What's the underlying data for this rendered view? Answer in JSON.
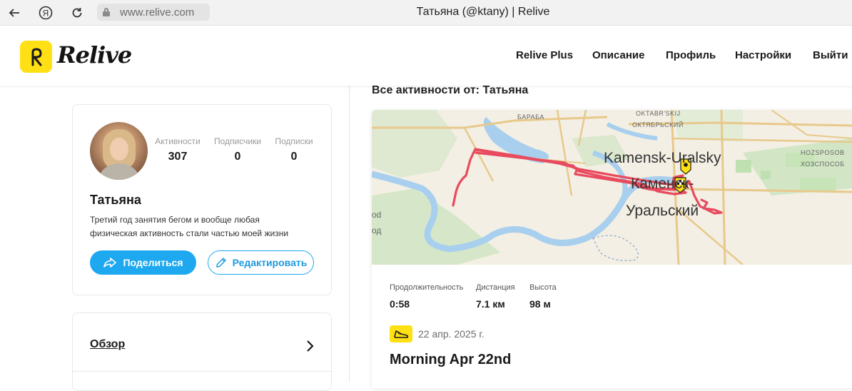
{
  "browser": {
    "url": "www.relive.com",
    "tab_title": "Татьяна (@ktany) | Relive",
    "icons": [
      "back-arrow-icon",
      "yandex-icon",
      "reload-icon",
      "lock-icon"
    ]
  },
  "header": {
    "brand": "Relive",
    "menu": [
      "Relive Plus",
      "Описание",
      "Профиль",
      "Настройки",
      "Выйти"
    ]
  },
  "profile": {
    "name": "Татьяна",
    "bio": "Третий год занятия бегом и вообще любая физическая активность стали частью моей жизни",
    "stats": [
      {
        "label": "Активности",
        "value": "307"
      },
      {
        "label": "Подписчики",
        "value": "0"
      },
      {
        "label": "Подписки",
        "value": "0"
      }
    ],
    "share_label": "Поделиться",
    "edit_label": "Редактировать"
  },
  "sidebar_nav": {
    "overview_label": "Обзор"
  },
  "feed": {
    "heading": "Все активности от: Татьяна",
    "activity": {
      "map_labels": {
        "baraba": "БАРАБА",
        "oktyabr_lat": "OKTABR'SKIJ",
        "oktyabr_cyr": "ОКТЯБРЬСКИЙ",
        "city_lat": "Kamensk-Uralsky",
        "city_cyr_1": "Каменск-",
        "city_cyr_2": "Уральский",
        "hozsposob_lat": "HOZSPOSOB",
        "hozsposob_cyr": "ХОЗСПОСОБ",
        "edge_1": "od",
        "edge_2": "од"
      },
      "stats": [
        {
          "label": "Продолжительность",
          "value": "0:58"
        },
        {
          "label": "Дистанция",
          "value": "7.1 км"
        },
        {
          "label": "Высота",
          "value": "98 м"
        }
      ],
      "sport_icon": "running-shoe-icon",
      "date": "22 апр. 2025 г.",
      "title": "Morning Apr 22nd"
    }
  },
  "colors": {
    "brand_yellow": "#ffe014",
    "accent_blue": "#1ea8f0",
    "route_red": "#e84a5f",
    "map_bg": "#f3efe4",
    "water": "#a8cfee",
    "park_green": "#cfe6c2"
  }
}
